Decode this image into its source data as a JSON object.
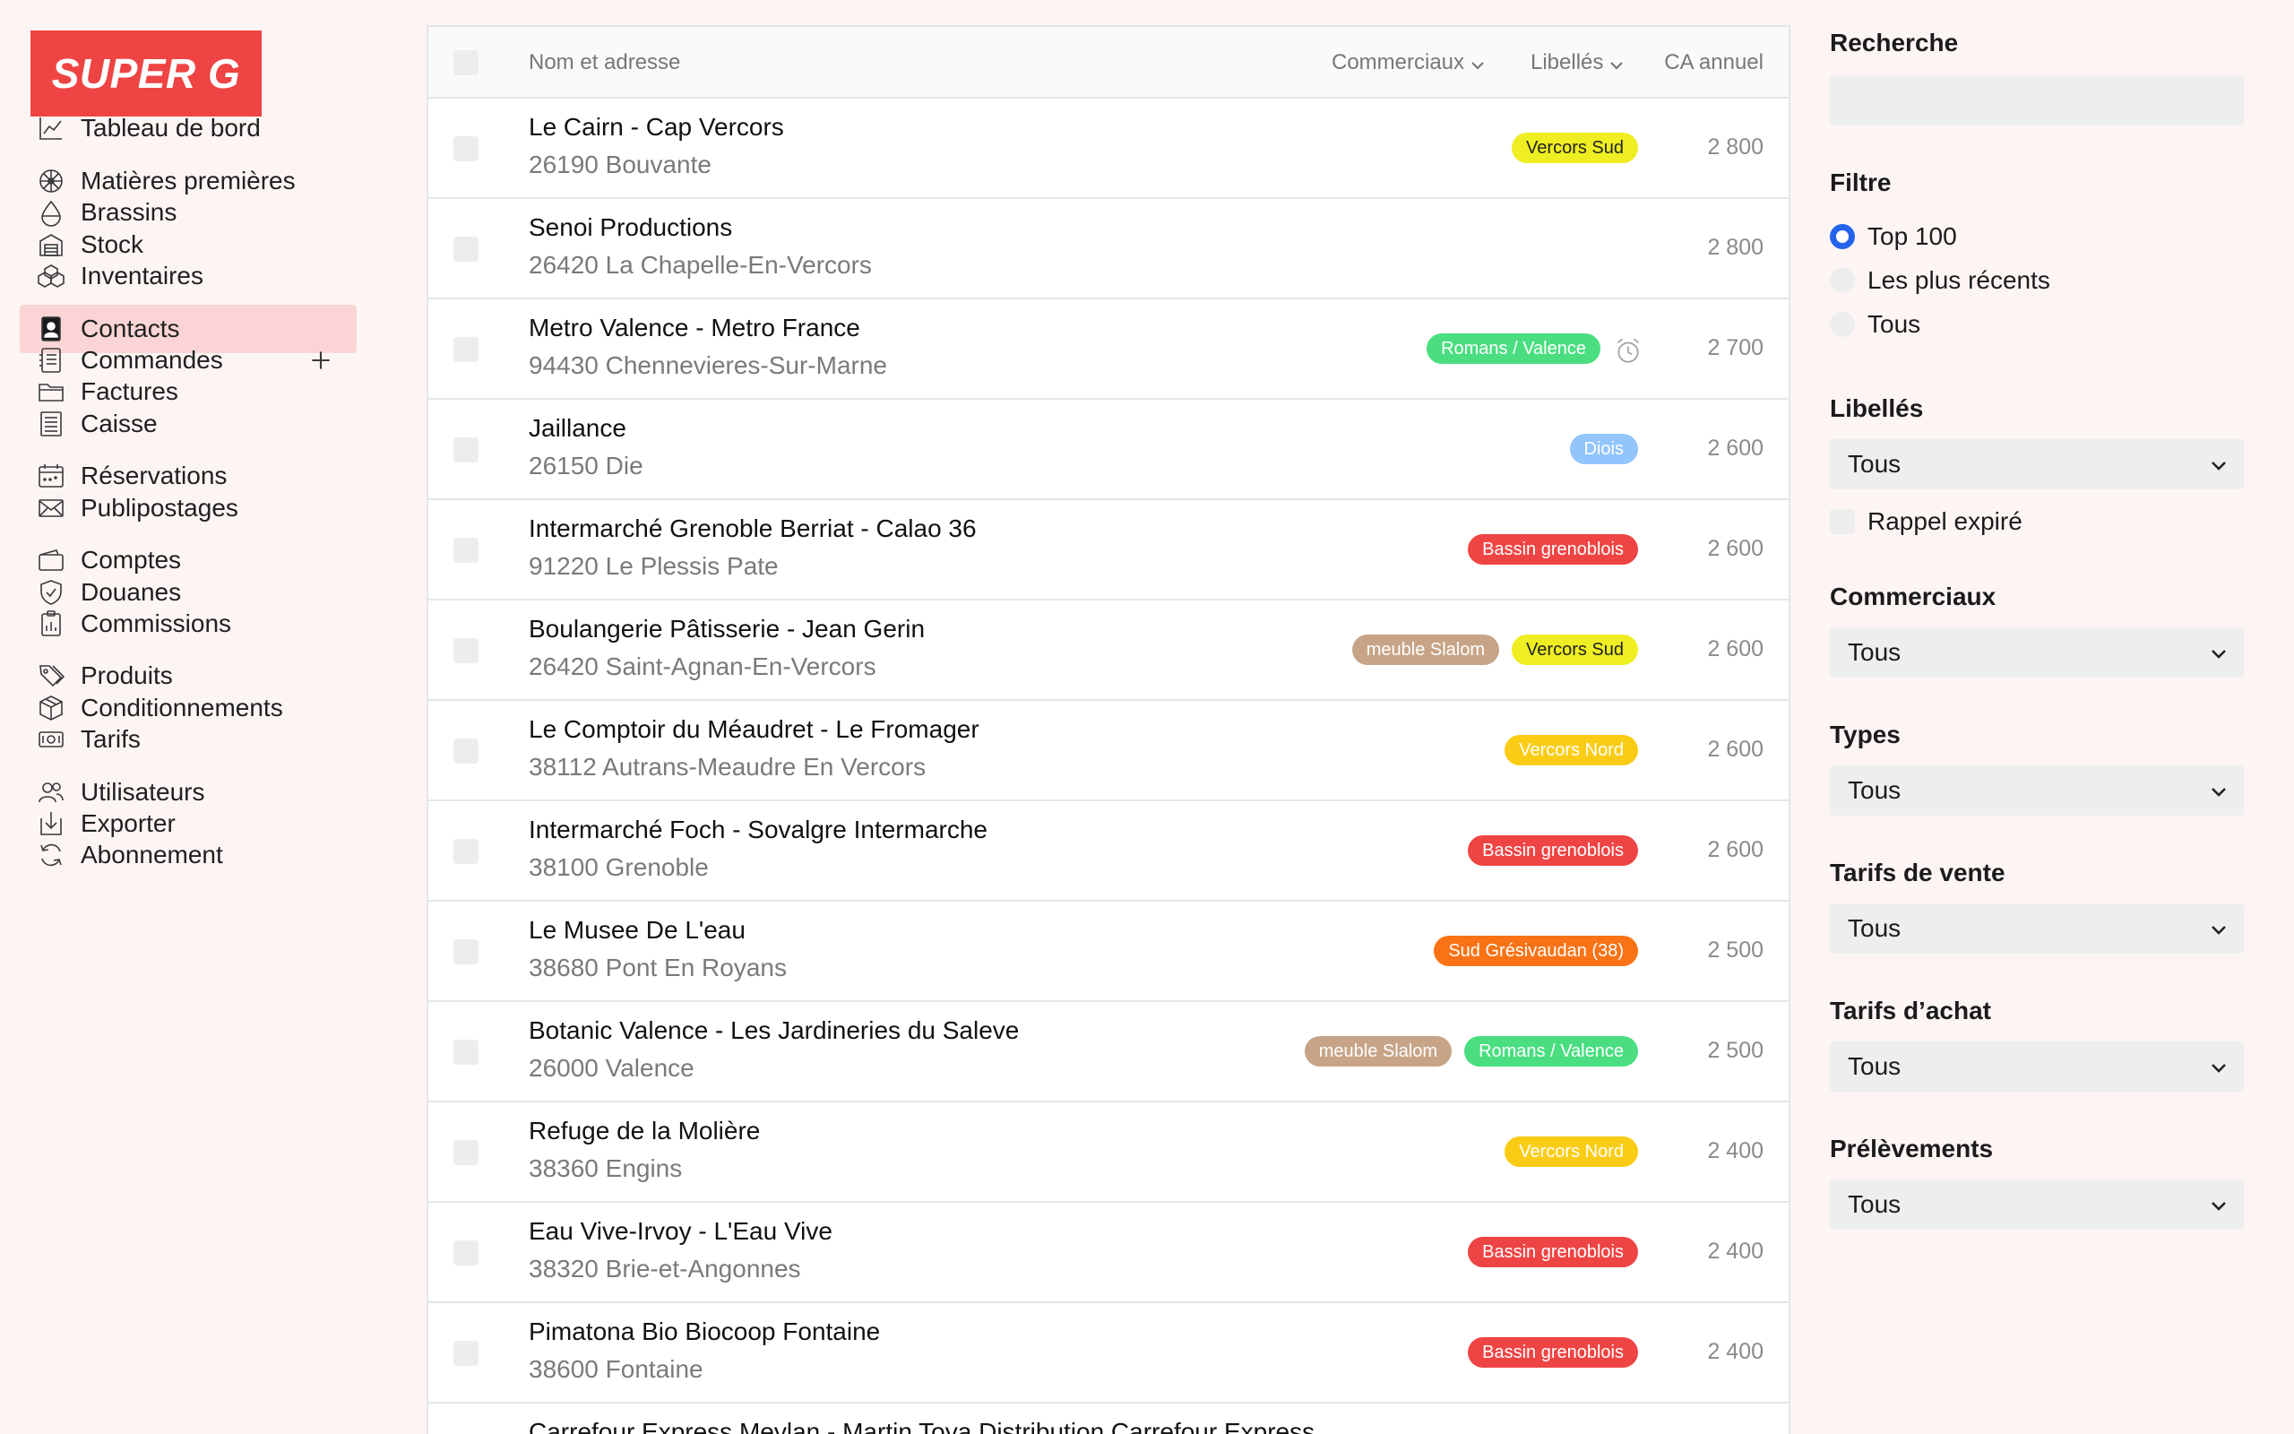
{
  "brand": {
    "logo_text": "SUPER G"
  },
  "sidebar": {
    "items": [
      {
        "label": "Tableau de bord",
        "icon": "chart-line-icon"
      },
      {
        "label": "Matières premières",
        "icon": "grain-icon"
      },
      {
        "label": "Brassins",
        "icon": "drop-icon"
      },
      {
        "label": "Stock",
        "icon": "warehouse-icon"
      },
      {
        "label": "Inventaires",
        "icon": "boxes-icon"
      },
      {
        "label": "Contacts",
        "icon": "contact-book-icon",
        "active": true
      },
      {
        "label": "Commandes",
        "icon": "order-list-icon",
        "add_icon": "plus-icon"
      },
      {
        "label": "Factures",
        "icon": "folder-icon"
      },
      {
        "label": "Caisse",
        "icon": "cash-register-icon"
      },
      {
        "label": "Réservations",
        "icon": "calendar-icon"
      },
      {
        "label": "Publipostages",
        "icon": "envelope-icon"
      },
      {
        "label": "Comptes",
        "icon": "wallet-icon"
      },
      {
        "label": "Douanes",
        "icon": "shield-icon"
      },
      {
        "label": "Commissions",
        "icon": "clipboard-chart-icon"
      },
      {
        "label": "Produits",
        "icon": "tags-icon"
      },
      {
        "label": "Conditionnements",
        "icon": "package-icon"
      },
      {
        "label": "Tarifs",
        "icon": "banknote-icon"
      },
      {
        "label": "Utilisateurs",
        "icon": "users-icon"
      },
      {
        "label": "Exporter",
        "icon": "download-icon"
      },
      {
        "label": "Abonnement",
        "icon": "refresh-icon"
      }
    ]
  },
  "list": {
    "columns": {
      "name": "Nom et adresse",
      "commerciaux": "Commerciaux",
      "libelles": "Libellés",
      "ca": "CA annuel"
    },
    "rows": [
      {
        "name": "Le Cairn - Cap Vercors",
        "address": "26190 Bouvante",
        "tags": [
          {
            "label": "Vercors Sud",
            "kind": "vercors-sud"
          }
        ],
        "ca": "2 800"
      },
      {
        "name": "Senoi Productions",
        "address": "26420 La Chapelle-En-Vercors",
        "tags": [],
        "ca": "2 800"
      },
      {
        "name": "Metro Valence - Metro France",
        "address": "94430 Chennevieres-Sur-Marne",
        "tags": [
          {
            "label": "Romans / Valence",
            "kind": "romans"
          }
        ],
        "alarm": "alarm-clock-icon",
        "ca": "2 700"
      },
      {
        "name": "Jaillance",
        "address": "26150 Die",
        "tags": [
          {
            "label": "Diois",
            "kind": "diois"
          }
        ],
        "ca": "2 600"
      },
      {
        "name": "Intermarché Grenoble Berriat - Calao 36",
        "address": "91220 Le Plessis Pate",
        "tags": [
          {
            "label": "Bassin grenoblois",
            "kind": "grenoblois"
          }
        ],
        "ca": "2 600"
      },
      {
        "name": "Boulangerie Pâtisserie - Jean Gerin",
        "address": "26420 Saint-Agnan-En-Vercors",
        "tags": [
          {
            "label": "meuble Slalom",
            "kind": "slalom"
          },
          {
            "label": "Vercors Sud",
            "kind": "vercors-sud"
          }
        ],
        "ca": "2 600"
      },
      {
        "name": "Le Comptoir du Méaudret - Le Fromager",
        "address": "38112 Autrans-Meaudre En Vercors",
        "tags": [
          {
            "label": "Vercors Nord",
            "kind": "vercors-nord"
          }
        ],
        "ca": "2 600"
      },
      {
        "name": "Intermarché Foch - Sovalgre Intermarche",
        "address": "38100 Grenoble",
        "tags": [
          {
            "label": "Bassin grenoblois",
            "kind": "grenoblois"
          }
        ],
        "ca": "2 600"
      },
      {
        "name": "Le Musee De L'eau",
        "address": "38680 Pont En Royans",
        "tags": [
          {
            "label": "Sud Grésivaudan (38)",
            "kind": "gresivaudan"
          }
        ],
        "ca": "2 500"
      },
      {
        "name": "Botanic Valence - Les Jardineries du Saleve",
        "address": "26000 Valence",
        "tags": [
          {
            "label": "meuble Slalom",
            "kind": "slalom"
          },
          {
            "label": "Romans / Valence",
            "kind": "romans"
          }
        ],
        "ca": "2 500"
      },
      {
        "name": "Refuge de la Molière",
        "address": "38360 Engins",
        "tags": [
          {
            "label": "Vercors Nord",
            "kind": "vercors-nord"
          }
        ],
        "ca": "2 400"
      },
      {
        "name": "Eau Vive-Irvoy - L'Eau Vive",
        "address": "38320 Brie-et-Angonnes",
        "tags": [
          {
            "label": "Bassin grenoblois",
            "kind": "grenoblois"
          }
        ],
        "ca": "2 400"
      },
      {
        "name": "Pimatona Bio Biocoop Fontaine",
        "address": "38600 Fontaine",
        "tags": [
          {
            "label": "Bassin grenoblois",
            "kind": "grenoblois"
          }
        ],
        "ca": "2 400"
      },
      {
        "name": "Carrefour Express Meylan - Martin Toya Distribution Carrefour Express",
        "address": "",
        "tags": [],
        "ca": ""
      }
    ]
  },
  "filters": {
    "search": {
      "title": "Recherche",
      "placeholder": ""
    },
    "filtre": {
      "title": "Filtre",
      "options": [
        {
          "label": "Top 100",
          "selected": true
        },
        {
          "label": "Les plus récents",
          "selected": false
        },
        {
          "label": "Tous",
          "selected": false
        }
      ]
    },
    "libelles": {
      "title": "Libellés",
      "value": "Tous",
      "checkbox_label": "Rappel expiré"
    },
    "commerciaux": {
      "title": "Commerciaux",
      "value": "Tous"
    },
    "types": {
      "title": "Types",
      "value": "Tous"
    },
    "tarifs_vente": {
      "title": "Tarifs de vente",
      "value": "Tous"
    },
    "tarifs_achat": {
      "title": "Tarifs d’achat",
      "value": "Tous"
    },
    "prelevements": {
      "title": "Prélèvements",
      "value": "Tous"
    }
  },
  "colors": {
    "brand": "#ef4444",
    "active_nav": "#fbd5d5",
    "radio_selected": "#2563eb"
  }
}
